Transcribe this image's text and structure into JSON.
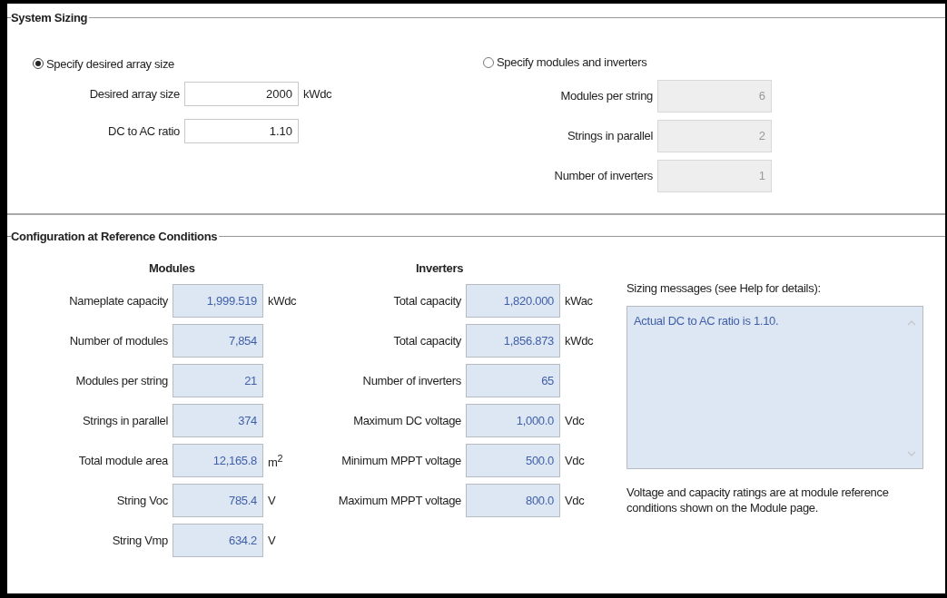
{
  "system_sizing": {
    "title": "System Sizing",
    "options": [
      {
        "label": "Specify desired array size",
        "selected": true,
        "fields": [
          {
            "label": "Desired array size",
            "value": "2000",
            "unit": "kWdc",
            "disabled": false
          },
          {
            "label": "DC to AC ratio",
            "value": "1.10",
            "disabled": false
          }
        ]
      },
      {
        "label": "Specify modules and inverters",
        "selected": false,
        "fields": [
          {
            "label": "Modules per string",
            "value": "6",
            "disabled": true
          },
          {
            "label": "Strings in parallel",
            "value": "2",
            "disabled": true
          },
          {
            "label": "Number of inverters",
            "value": "1",
            "disabled": true
          }
        ]
      }
    ]
  },
  "configuration": {
    "title": "Configuration at Reference Conditions",
    "groups": [
      {
        "heading": "Modules",
        "rows": [
          {
            "label": "Nameplate capacity",
            "value": "1,999.519",
            "unit": "kWdc"
          },
          {
            "label": "Number of modules",
            "value": "7,854"
          },
          {
            "label": "Modules per string",
            "value": "21"
          },
          {
            "label": "Strings in parallel",
            "value": "374"
          },
          {
            "label": "Total module area",
            "value": "12,165.8",
            "unit": "m$^{2}$"
          },
          {
            "label": "String Voc",
            "value": "785.4",
            "unit": "V"
          },
          {
            "label": "String Vmp",
            "value": "634.2",
            "unit": "V"
          }
        ]
      },
      {
        "heading": "Inverters",
        "rows": [
          {
            "label": "Total capacity",
            "value": "1,820.000",
            "unit": "kWac"
          },
          {
            "label": "Total capacity",
            "value": "1,856.873",
            "unit": "kWdc"
          },
          {
            "label": "Number of inverters",
            "value": "65"
          },
          {
            "label": "Maximum DC voltage",
            "value": "1,000.0",
            "unit": "Vdc"
          },
          {
            "label": "Minimum MPPT voltage",
            "value": "500.0",
            "unit": "Vdc"
          },
          {
            "label": "Maximum MPPT voltage",
            "value": "800.0",
            "unit": "Vdc"
          }
        ]
      }
    ],
    "messages": {
      "label": "Sizing messages (see Help for details):",
      "text": "Actual DC to AC ratio is 1.10."
    },
    "note": "Voltage and capacity ratings are at module reference conditions shown on the Module page."
  }
}
